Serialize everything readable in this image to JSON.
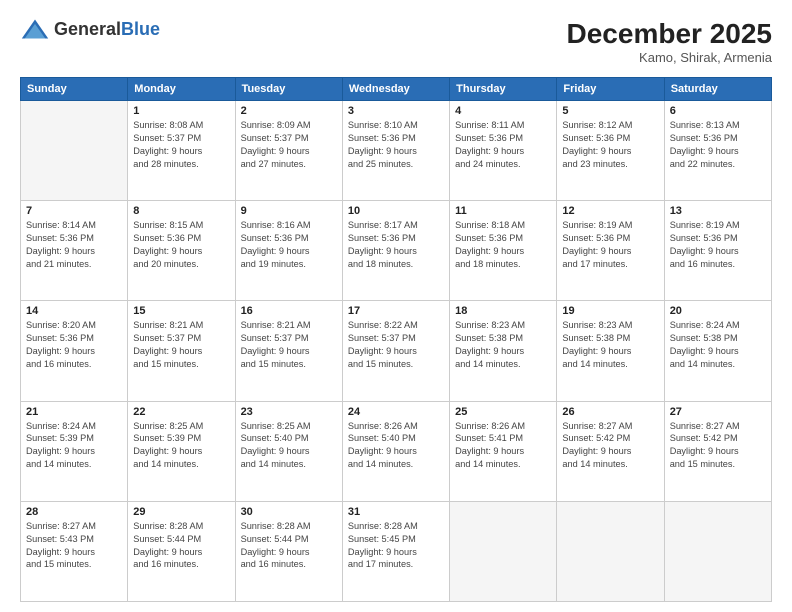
{
  "header": {
    "logo_general": "General",
    "logo_blue": "Blue",
    "month_title": "December 2025",
    "location": "Kamo, Shirak, Armenia"
  },
  "days_of_week": [
    "Sunday",
    "Monday",
    "Tuesday",
    "Wednesday",
    "Thursday",
    "Friday",
    "Saturday"
  ],
  "weeks": [
    [
      {
        "day": "",
        "info": ""
      },
      {
        "day": "1",
        "info": "Sunrise: 8:08 AM\nSunset: 5:37 PM\nDaylight: 9 hours\nand 28 minutes."
      },
      {
        "day": "2",
        "info": "Sunrise: 8:09 AM\nSunset: 5:37 PM\nDaylight: 9 hours\nand 27 minutes."
      },
      {
        "day": "3",
        "info": "Sunrise: 8:10 AM\nSunset: 5:36 PM\nDaylight: 9 hours\nand 25 minutes."
      },
      {
        "day": "4",
        "info": "Sunrise: 8:11 AM\nSunset: 5:36 PM\nDaylight: 9 hours\nand 24 minutes."
      },
      {
        "day": "5",
        "info": "Sunrise: 8:12 AM\nSunset: 5:36 PM\nDaylight: 9 hours\nand 23 minutes."
      },
      {
        "day": "6",
        "info": "Sunrise: 8:13 AM\nSunset: 5:36 PM\nDaylight: 9 hours\nand 22 minutes."
      }
    ],
    [
      {
        "day": "7",
        "info": "Sunrise: 8:14 AM\nSunset: 5:36 PM\nDaylight: 9 hours\nand 21 minutes."
      },
      {
        "day": "8",
        "info": "Sunrise: 8:15 AM\nSunset: 5:36 PM\nDaylight: 9 hours\nand 20 minutes."
      },
      {
        "day": "9",
        "info": "Sunrise: 8:16 AM\nSunset: 5:36 PM\nDaylight: 9 hours\nand 19 minutes."
      },
      {
        "day": "10",
        "info": "Sunrise: 8:17 AM\nSunset: 5:36 PM\nDaylight: 9 hours\nand 18 minutes."
      },
      {
        "day": "11",
        "info": "Sunrise: 8:18 AM\nSunset: 5:36 PM\nDaylight: 9 hours\nand 18 minutes."
      },
      {
        "day": "12",
        "info": "Sunrise: 8:19 AM\nSunset: 5:36 PM\nDaylight: 9 hours\nand 17 minutes."
      },
      {
        "day": "13",
        "info": "Sunrise: 8:19 AM\nSunset: 5:36 PM\nDaylight: 9 hours\nand 16 minutes."
      }
    ],
    [
      {
        "day": "14",
        "info": "Sunrise: 8:20 AM\nSunset: 5:36 PM\nDaylight: 9 hours\nand 16 minutes."
      },
      {
        "day": "15",
        "info": "Sunrise: 8:21 AM\nSunset: 5:37 PM\nDaylight: 9 hours\nand 15 minutes."
      },
      {
        "day": "16",
        "info": "Sunrise: 8:21 AM\nSunset: 5:37 PM\nDaylight: 9 hours\nand 15 minutes."
      },
      {
        "day": "17",
        "info": "Sunrise: 8:22 AM\nSunset: 5:37 PM\nDaylight: 9 hours\nand 15 minutes."
      },
      {
        "day": "18",
        "info": "Sunrise: 8:23 AM\nSunset: 5:38 PM\nDaylight: 9 hours\nand 14 minutes."
      },
      {
        "day": "19",
        "info": "Sunrise: 8:23 AM\nSunset: 5:38 PM\nDaylight: 9 hours\nand 14 minutes."
      },
      {
        "day": "20",
        "info": "Sunrise: 8:24 AM\nSunset: 5:38 PM\nDaylight: 9 hours\nand 14 minutes."
      }
    ],
    [
      {
        "day": "21",
        "info": "Sunrise: 8:24 AM\nSunset: 5:39 PM\nDaylight: 9 hours\nand 14 minutes."
      },
      {
        "day": "22",
        "info": "Sunrise: 8:25 AM\nSunset: 5:39 PM\nDaylight: 9 hours\nand 14 minutes."
      },
      {
        "day": "23",
        "info": "Sunrise: 8:25 AM\nSunset: 5:40 PM\nDaylight: 9 hours\nand 14 minutes."
      },
      {
        "day": "24",
        "info": "Sunrise: 8:26 AM\nSunset: 5:40 PM\nDaylight: 9 hours\nand 14 minutes."
      },
      {
        "day": "25",
        "info": "Sunrise: 8:26 AM\nSunset: 5:41 PM\nDaylight: 9 hours\nand 14 minutes."
      },
      {
        "day": "26",
        "info": "Sunrise: 8:27 AM\nSunset: 5:42 PM\nDaylight: 9 hours\nand 14 minutes."
      },
      {
        "day": "27",
        "info": "Sunrise: 8:27 AM\nSunset: 5:42 PM\nDaylight: 9 hours\nand 15 minutes."
      }
    ],
    [
      {
        "day": "28",
        "info": "Sunrise: 8:27 AM\nSunset: 5:43 PM\nDaylight: 9 hours\nand 15 minutes."
      },
      {
        "day": "29",
        "info": "Sunrise: 8:28 AM\nSunset: 5:44 PM\nDaylight: 9 hours\nand 16 minutes."
      },
      {
        "day": "30",
        "info": "Sunrise: 8:28 AM\nSunset: 5:44 PM\nDaylight: 9 hours\nand 16 minutes."
      },
      {
        "day": "31",
        "info": "Sunrise: 8:28 AM\nSunset: 5:45 PM\nDaylight: 9 hours\nand 17 minutes."
      },
      {
        "day": "",
        "info": ""
      },
      {
        "day": "",
        "info": ""
      },
      {
        "day": "",
        "info": ""
      }
    ]
  ]
}
